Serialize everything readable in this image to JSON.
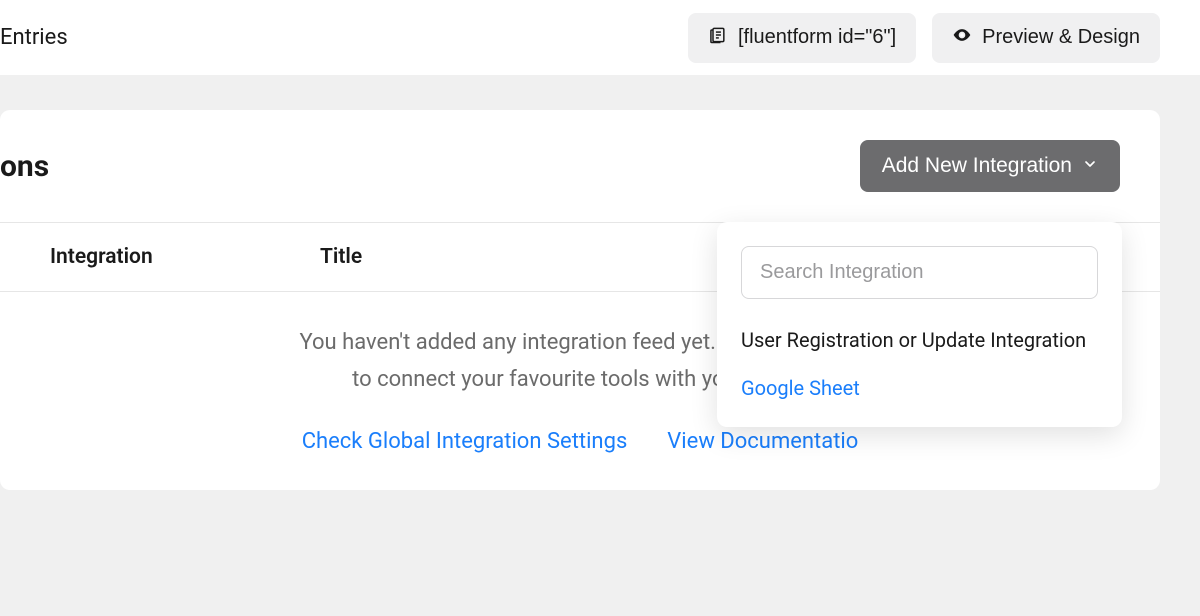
{
  "topbar": {
    "left_label": "Entries",
    "shortcode": "[fluentform id=\"6\"]",
    "preview_label": "Preview & Design"
  },
  "card": {
    "title_fragment": "ons",
    "add_button_label": "Add New Integration",
    "columns": {
      "integration": "Integration",
      "title": "Title"
    },
    "empty": {
      "line1": "You haven't added any integration feed yet. Add new integ",
      "line2": "to connect your favourite tools with your forms",
      "link_settings": "Check Global Integration Settings",
      "link_docs": "View Documentatio"
    }
  },
  "dropdown": {
    "search_placeholder": "Search Integration",
    "items": [
      {
        "label": "User Registration or Update Integration",
        "active": false
      },
      {
        "label": "Google Sheet",
        "active": true
      }
    ]
  }
}
